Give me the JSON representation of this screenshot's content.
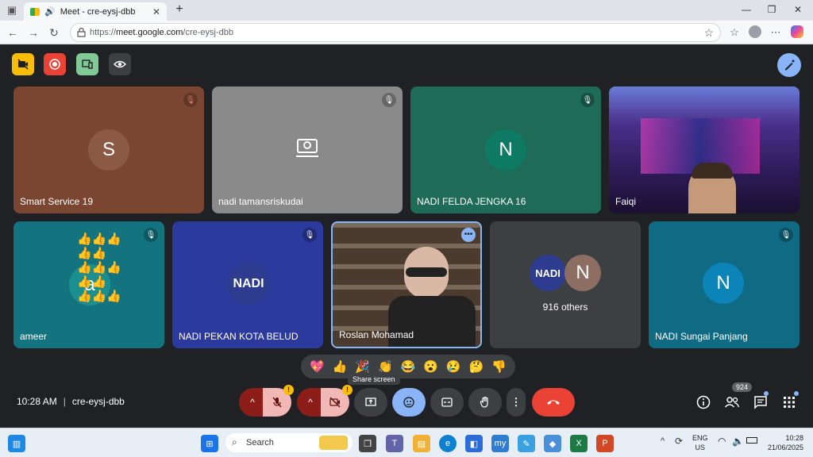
{
  "browser": {
    "tab_title": "Meet - cre-eysj-dbb",
    "url_scheme": "https://",
    "url_host": "meet.google.com",
    "url_path": "/cre-eysj-dbb"
  },
  "participants": [
    {
      "name": "Smart Service 19",
      "initial": "S",
      "bg": "#7a4631",
      "avatar_bg": "#8c5a44"
    },
    {
      "name": "nadi tamansriskudai",
      "initial": "",
      "bg": "#8a8a8a"
    },
    {
      "name": "NADI FELDA JENGKA 16",
      "initial": "N",
      "bg": "#1e6b58",
      "avatar_bg": "#1a7a64"
    },
    {
      "name": "Faiqi",
      "initial": "",
      "bg": "#3a2a6e"
    },
    {
      "name": "ameer",
      "initial": "a",
      "bg": "#137480",
      "avatar_bg": "#1b8f8f"
    },
    {
      "name": "NADI PEKAN KOTA BELUD",
      "initial": "NADI",
      "bg": "#2c3a9e",
      "avatar_bg": "#2e3c8f"
    },
    {
      "name": "Roslan Mohamad",
      "initial": "",
      "bg": "#5b4a3b"
    },
    {
      "name": "916 others",
      "initial": "N",
      "bg": "#3c4043",
      "avatar_bg": "#8d6e63"
    },
    {
      "name": "NADI Sungai Panjang",
      "initial": "N",
      "bg": "#0f6a84",
      "avatar_bg": "#0c84b8"
    }
  ],
  "nadi_small_label": "NADI",
  "others_label": "916 others",
  "reactions": [
    "💖",
    "👍",
    "🎉",
    "👏",
    "😂",
    "😮",
    "😢",
    "🤔",
    "👎"
  ],
  "tooltip": "Share screen",
  "meeting": {
    "time": "10:28 AM",
    "separator": "|",
    "code": "cre-eysj-dbb"
  },
  "people_count": "924",
  "taskbar": {
    "search_label": "Search",
    "lang_1": "ENG",
    "lang_2": "US",
    "clock_time": "10:28",
    "clock_date": "21/06/2025"
  },
  "colors": {
    "leave_red": "#ea4335",
    "muted_red": "#c5221f",
    "active_blue": "#8ab4f8"
  }
}
